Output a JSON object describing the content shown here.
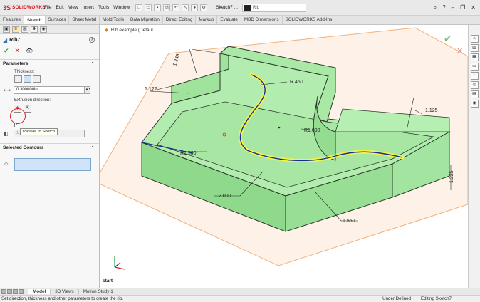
{
  "app": {
    "logo_text": "SOLIDWORKS",
    "menu": [
      "File",
      "Edit",
      "View",
      "Insert",
      "Tools",
      "Window"
    ],
    "document_title": "Sketch7 ...",
    "search_placeholder": "Rib"
  },
  "command_tabs": [
    "Features",
    "Sketch",
    "Surfaces",
    "Sheet Metal",
    "Mold Tools",
    "Data Migration",
    "Direct Editing",
    "Markup",
    "Evaluate",
    "MBD Dimensions",
    "SOLIDWORKS Add-Ins"
  ],
  "active_command_tab": "Sketch",
  "property_manager": {
    "title": "Rib7",
    "help_label": "?",
    "parameters_header": "Parameters",
    "thickness_label": "Thickness:",
    "thickness_value": "0.300000in",
    "extrusion_direction_label": "Extrusion direction:",
    "tooltip": "Parallel to Sketch",
    "draft_value": "1.00deg",
    "selected_contours_header": "Selected Contours"
  },
  "graphics": {
    "breadcrumb": "Rib example (Defaul...",
    "start_label": "start",
    "dimensions": {
      "d1": "1.348",
      "d2": "1.122",
      "d3": "R.450",
      "d4": "1.125",
      "d5": "R1.000",
      "d6": "R1.500",
      "d7": "2.000",
      "d8": "1.550",
      "d9": "1.225"
    },
    "colors": {
      "part_fill": "#9fe39c",
      "part_edge": "#2b3a2b",
      "sketch_plane": "#f4b07a",
      "rib_preview": "#f2f24b",
      "sketch_curve": "#1a2d8f"
    }
  },
  "bottom_tabs": [
    "Model",
    "3D Views",
    "Motion Study 1"
  ],
  "active_bottom_tab": "Model",
  "status_bar": {
    "message": "Set direction, thickness and other parameters to create the rib.",
    "state": "Under Defined",
    "mode": "Editing Sketch7"
  }
}
